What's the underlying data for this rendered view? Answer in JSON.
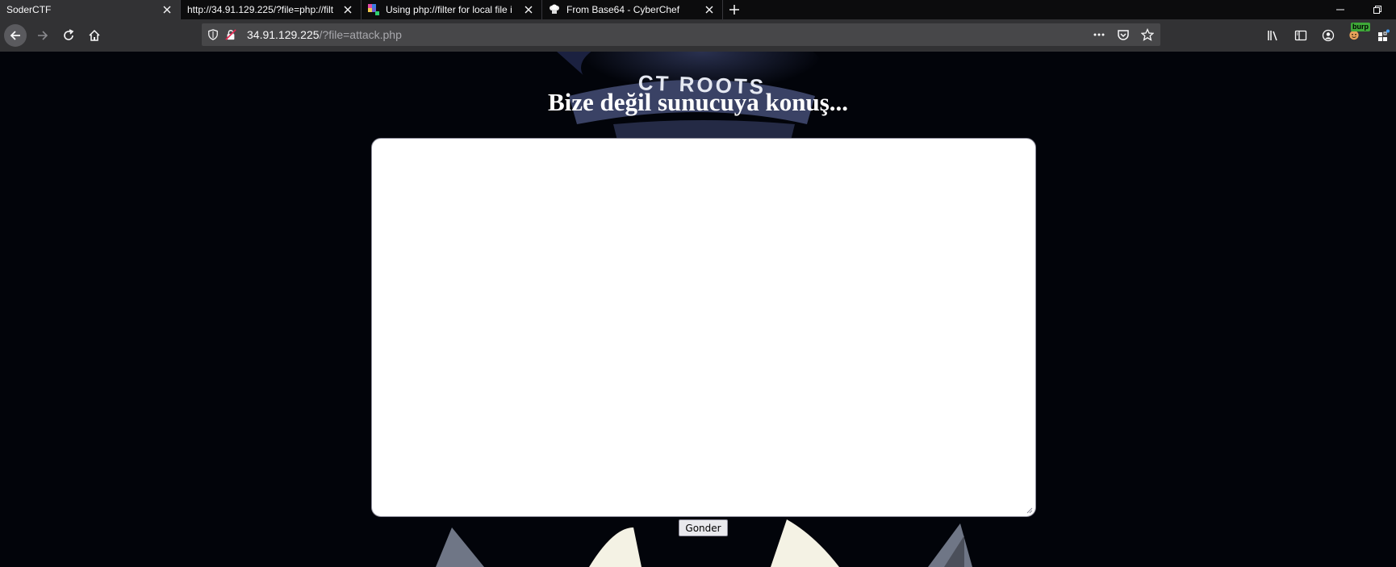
{
  "tabs": [
    {
      "title": "SoderCTF",
      "active": true
    },
    {
      "title": "http://34.91.129.225/?file=php://filt",
      "active": false
    },
    {
      "title": "Using php://filter for local file i",
      "active": false
    },
    {
      "title": "From Base64 - CyberChef",
      "active": false
    }
  ],
  "url": {
    "host": "34.91.129.225",
    "path": "/?file=attack.php"
  },
  "toolbar": {
    "burp_badge": "burp"
  },
  "page": {
    "background_logo_text": "CT ROOTS",
    "heading": "Bize değil sunucuya konuş...",
    "textarea_value": "",
    "submit_label": "Gonder"
  },
  "colors": {
    "tabstrip_bg": "#0c0c0d",
    "toolbar_bg": "#323234",
    "urlbar_bg": "#474749",
    "page_bg": "#02040a",
    "text_light": "#f9f9fa"
  }
}
